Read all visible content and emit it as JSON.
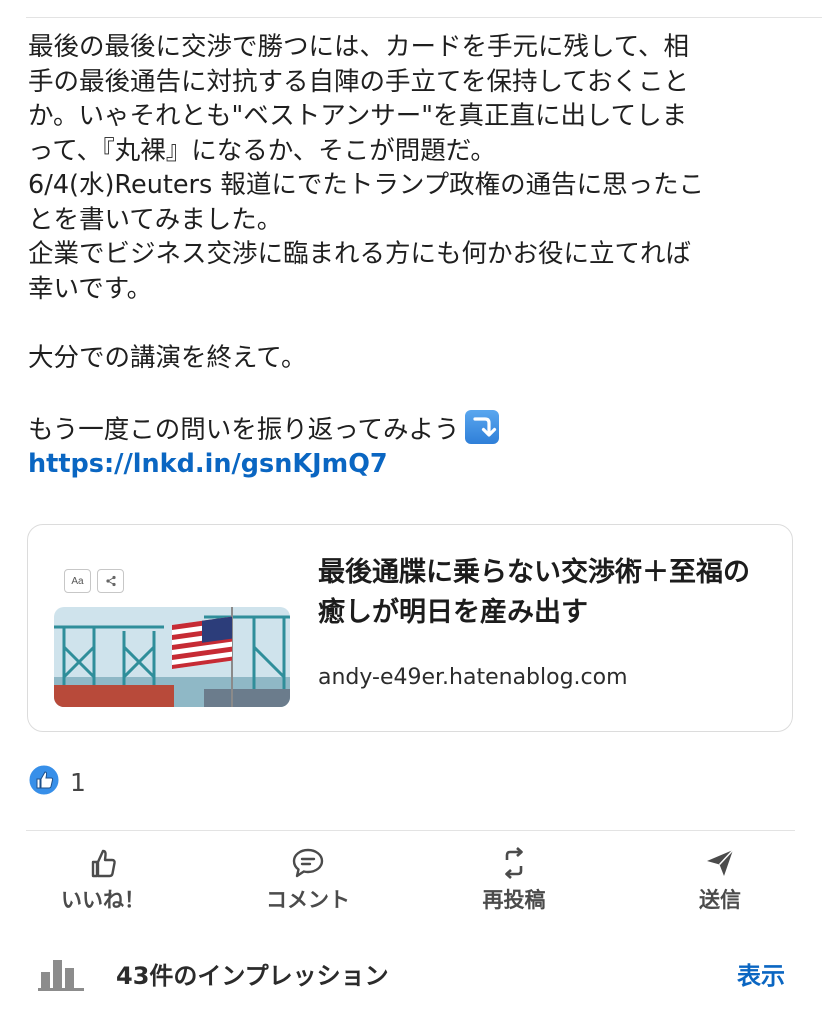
{
  "post": {
    "lines": [
      "最後の最後に交渉で勝つには、カードを手元に残して、相",
      "手の最後通告に対抗する自陣の手立てを保持しておくこと",
      "か。いゃそれとも\"ベストアンサー\"を真正直に出してしま",
      "って、『丸裸』になるか、そこが問題だ。",
      "6/4(水)Reuters 報道にでたトランプ政権の通告に思ったこ",
      "とを書いてみました。",
      "企業でビジネス交渉に臨まれる方にも何かお役に立てれば",
      "幸いです。",
      "",
      "大分での講演を終えて。",
      "",
      "もう一度この問いを振り返ってみよう"
    ],
    "link": "https://lnkd.in/gsnKJmQ7"
  },
  "card": {
    "title": "最後通牒に乗らない交渉術＋至福の癒しが明日を産み出す",
    "domain": "andy-e49er.hatenablog.com",
    "thumb_font_button": "Aa"
  },
  "reactions": {
    "count": "1"
  },
  "actions": {
    "like": "いいね！",
    "comment": "コメント",
    "repost": "再投稿",
    "send": "送信"
  },
  "impressions": {
    "text": "43件のインプレッション",
    "show": "表示"
  },
  "colors": {
    "link": "#0a66c2",
    "like_badge": "#378fe9"
  }
}
